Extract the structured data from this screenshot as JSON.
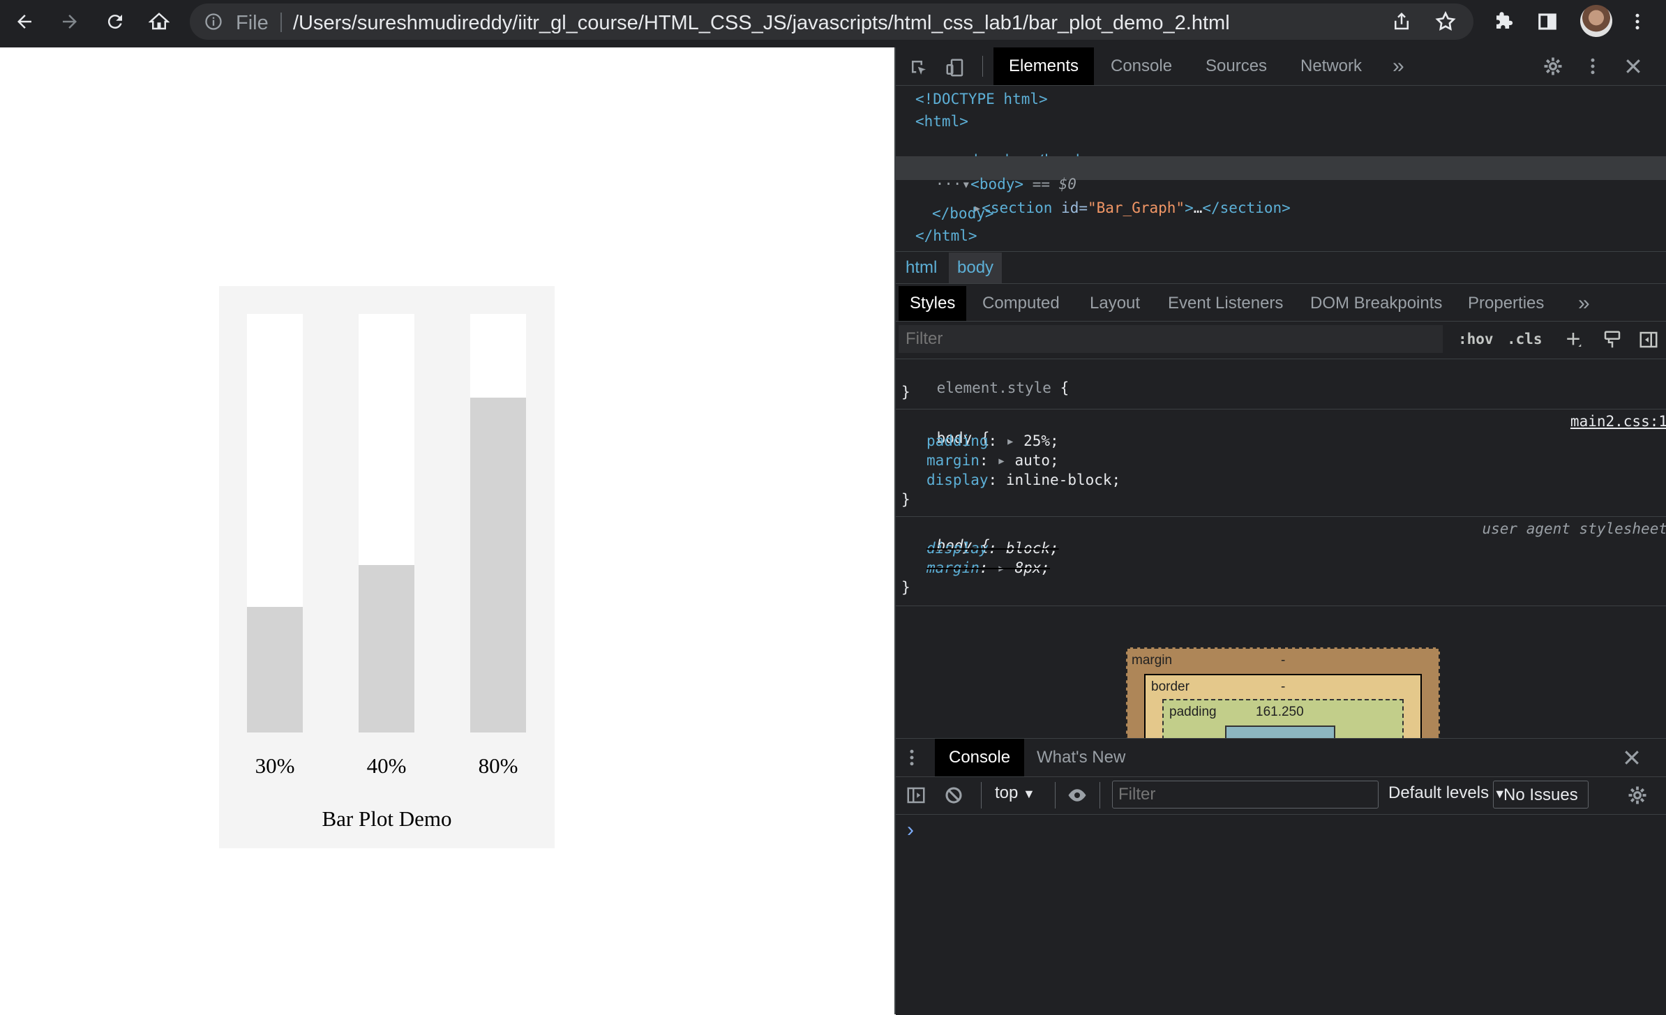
{
  "browser": {
    "file_label": "File",
    "url": "/Users/sureshmudireddy/iitr_gl_course/HTML_CSS_JS/javascripts/html_css_lab1/bar_plot_demo_2.html",
    "icons": [
      "back-icon",
      "forward-icon",
      "reload-icon",
      "home-icon",
      "info-icon",
      "share-icon",
      "star-icon",
      "extensions-icon",
      "side-panel-icon",
      "avatar",
      "menu-icon"
    ]
  },
  "chart_data": {
    "type": "bar",
    "categories": [
      "30%",
      "40%",
      "80%"
    ],
    "values": [
      30,
      40,
      80
    ],
    "title": "Bar Plot Demo",
    "xlabel": "",
    "ylabel": "",
    "ylim": [
      0,
      100
    ],
    "colors": {
      "bar": "#d3d3d3",
      "track": "#ffffff",
      "background": "#f4f4f4"
    }
  },
  "devtools": {
    "tabs": [
      "Elements",
      "Console",
      "Sources",
      "Network"
    ],
    "more_tabs": "»",
    "dom": {
      "doctype": "<!DOCTYPE html>",
      "html_open": "<html>",
      "head_open": "<head>",
      "head_ellipsis": "…",
      "head_close": "</head>",
      "body_open": "<body>",
      "body_marker": "== $0",
      "section_open": "<section",
      "section_attr": "id=",
      "section_value": "\"Bar_Graph\"",
      "section_gt": ">",
      "section_ellipsis": "…",
      "section_close": "</section>",
      "body_close": "</body>",
      "html_close": "</html>",
      "dots": "···"
    },
    "breadcrumbs": [
      "html",
      "body"
    ],
    "subtabs": [
      "Styles",
      "Computed",
      "Layout",
      "Event Listeners",
      "DOM Breakpoints",
      "Properties"
    ],
    "filter_placeholder": "Filter",
    "hov": ":hov",
    "cls": ".cls",
    "rules": {
      "element_style": "element.style",
      "open_brace": "{",
      "close_brace": "}",
      "rule1_selector": "body",
      "rule1_source": "main2.css:1",
      "rule1_props": [
        {
          "name": "padding",
          "value": "25%;"
        },
        {
          "name": "margin",
          "value": "auto;"
        },
        {
          "name": "display",
          "value": "inline-block;"
        }
      ],
      "rule2_selector": "body",
      "rule2_source": "user agent stylesheet",
      "rule2_props": [
        {
          "name": "display",
          "value": "block;"
        },
        {
          "name": "margin",
          "value": "8px;"
        }
      ]
    },
    "box_model": {
      "margin_label": "margin",
      "margin_value": "-",
      "border_label": "border",
      "border_value": "-",
      "padding_label": "padding",
      "padding_value": "161.250"
    },
    "drawer": {
      "tabs": [
        "Console",
        "What's New"
      ],
      "context": "top",
      "filter_placeholder": "Filter",
      "levels": "Default levels",
      "issues": "No Issues",
      "prompt": "›"
    }
  }
}
